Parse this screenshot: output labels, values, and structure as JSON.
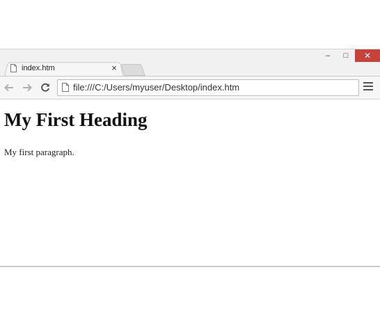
{
  "tab": {
    "title": "index.htm",
    "close_label": "×"
  },
  "window_controls": {
    "minimize": "–",
    "maximize": "□",
    "close": "✕"
  },
  "toolbar": {
    "url": "file:///C:/Users/myuser/Desktop/index.htm"
  },
  "page": {
    "heading": "My First Heading",
    "paragraph": "My first paragraph."
  },
  "icons": {
    "tab_icon": "file-icon",
    "back": "back-arrow-icon",
    "forward": "forward-arrow-icon",
    "reload": "reload-icon",
    "address_icon": "file-icon",
    "menu": "hamburger-menu-icon"
  },
  "colors": {
    "close_button": "#c7423a",
    "chrome_frame": "#f1f1f1"
  }
}
